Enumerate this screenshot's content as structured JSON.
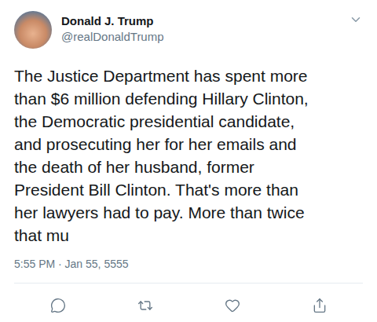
{
  "user": {
    "name": "Donald J. Trump",
    "handle": "@realDonaldTrump"
  },
  "tweet": {
    "lines": [
      "The Justice Department has spent more",
      "than $6 million defending Hillary Clinton,",
      "the Democratic presidential candidate,",
      "and prosecuting her for her emails and",
      "the death of her husband, former",
      "President Bill Clinton. That's more than",
      "her lawyers had to pay. More than twice",
      "that mu"
    ]
  },
  "timestamp": "5:55 PM · Jan 55, 5555"
}
